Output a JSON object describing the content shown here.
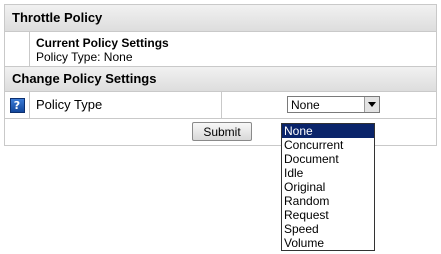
{
  "header": {
    "title": "Throttle Policy"
  },
  "current": {
    "heading": "Current Policy Settings",
    "policy_type_text": "Policy Type: None"
  },
  "change": {
    "heading": "Change Policy Settings"
  },
  "policy_type": {
    "label": "Policy Type",
    "help_icon": "help-icon",
    "selected": "None",
    "options": [
      "None",
      "Concurrent",
      "Document",
      "Idle",
      "Original",
      "Random",
      "Request",
      "Speed",
      "Volume"
    ]
  },
  "submit": {
    "label": "Submit"
  },
  "colors": {
    "highlight": "#0a246a",
    "header_bg": "#e6e6e6",
    "border": "#c9c9c9"
  }
}
